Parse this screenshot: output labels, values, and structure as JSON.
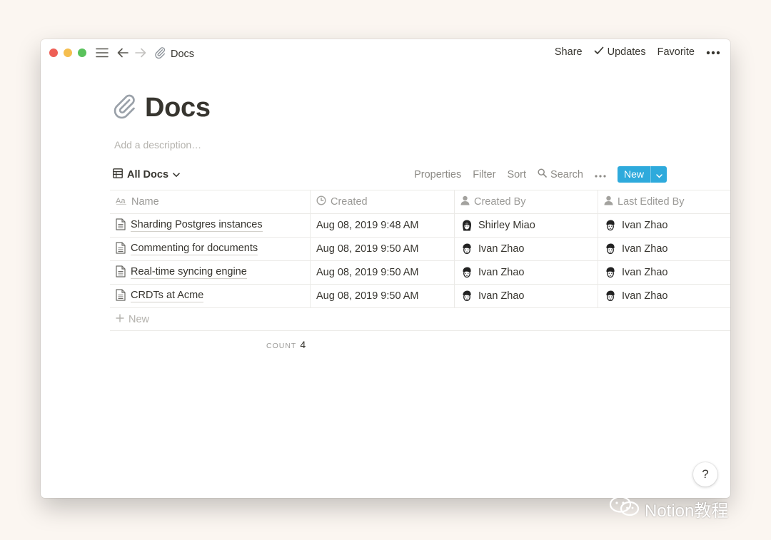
{
  "topbar": {
    "breadcrumb": "Docs",
    "actions": {
      "share": "Share",
      "updates": "Updates",
      "favorite": "Favorite"
    }
  },
  "page": {
    "title": "Docs",
    "description_placeholder": "Add a description…"
  },
  "view": {
    "name": "All Docs",
    "properties": "Properties",
    "filter": "Filter",
    "sort": "Sort",
    "search": "Search",
    "new_button": "New"
  },
  "table": {
    "columns": [
      "Name",
      "Created",
      "Created By",
      "Last Edited By"
    ],
    "rows": [
      {
        "name": "Sharding Postgres instances",
        "created": "Aug 08, 2019 9:48 AM",
        "created_by": "Shirley Miao",
        "last_edited_by": "Ivan Zhao"
      },
      {
        "name": "Commenting for documents",
        "created": "Aug 08, 2019 9:50 AM",
        "created_by": "Ivan Zhao",
        "last_edited_by": "Ivan Zhao"
      },
      {
        "name": "Real-time syncing engine",
        "created": "Aug 08, 2019 9:50 AM",
        "created_by": "Ivan Zhao",
        "last_edited_by": "Ivan Zhao"
      },
      {
        "name": "CRDTs at Acme",
        "created": "Aug 08, 2019 9:50 AM",
        "created_by": "Ivan Zhao",
        "last_edited_by": "Ivan Zhao"
      }
    ],
    "new_row_label": "New",
    "count_label": "COUNT",
    "count_value": "4"
  },
  "help": "?",
  "watermark": "Notion教程",
  "colors": {
    "accent": "#2eaadc",
    "text": "#37352f",
    "muted": "#9b9a97",
    "border": "#ebeae7"
  },
  "icons": [
    "hamburger-icon",
    "back-arrow-icon",
    "forward-arrow-icon",
    "paperclip-icon",
    "check-icon",
    "more-icon",
    "table-icon",
    "chevron-down-icon",
    "text-property-icon",
    "clock-icon",
    "person-icon",
    "page-icon",
    "search-icon",
    "plus-icon"
  ]
}
